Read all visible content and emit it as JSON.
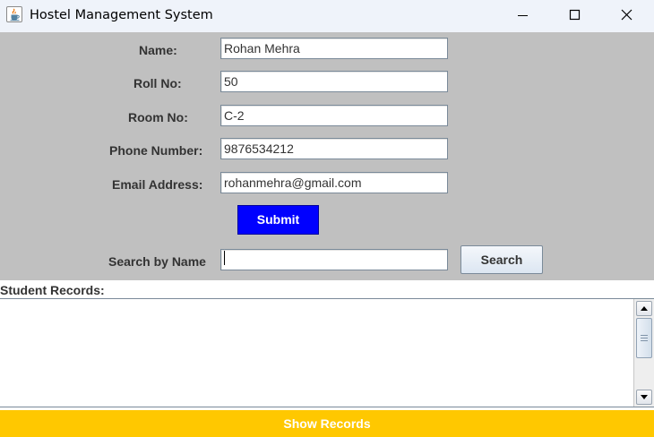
{
  "window": {
    "title": "Hostel Management System",
    "icon": "java-cup-icon",
    "controls": [
      "minimize-icon",
      "maximize-icon",
      "close-icon"
    ]
  },
  "form": {
    "fields": [
      {
        "label": "Name:",
        "value": "Rohan Mehra"
      },
      {
        "label": "Roll No:",
        "value": "50"
      },
      {
        "label": "Room No:",
        "value": "C-2"
      },
      {
        "label": "Phone Number:",
        "value": "9876534212"
      },
      {
        "label": "Email Address:",
        "value": "rohanmehra@gmail.com"
      }
    ],
    "submit_label": "Submit",
    "search_label": "Search by Name",
    "search_value": "",
    "search_button_label": "Search"
  },
  "records": {
    "label": "Student Records:",
    "content": "",
    "show_records_label": "Show Records"
  },
  "colors": {
    "panel_bg": "#c0c0c0",
    "submit_bg": "#0000ff",
    "show_records_bg": "#ffc800",
    "titlebar_bg": "#eff3fa"
  }
}
